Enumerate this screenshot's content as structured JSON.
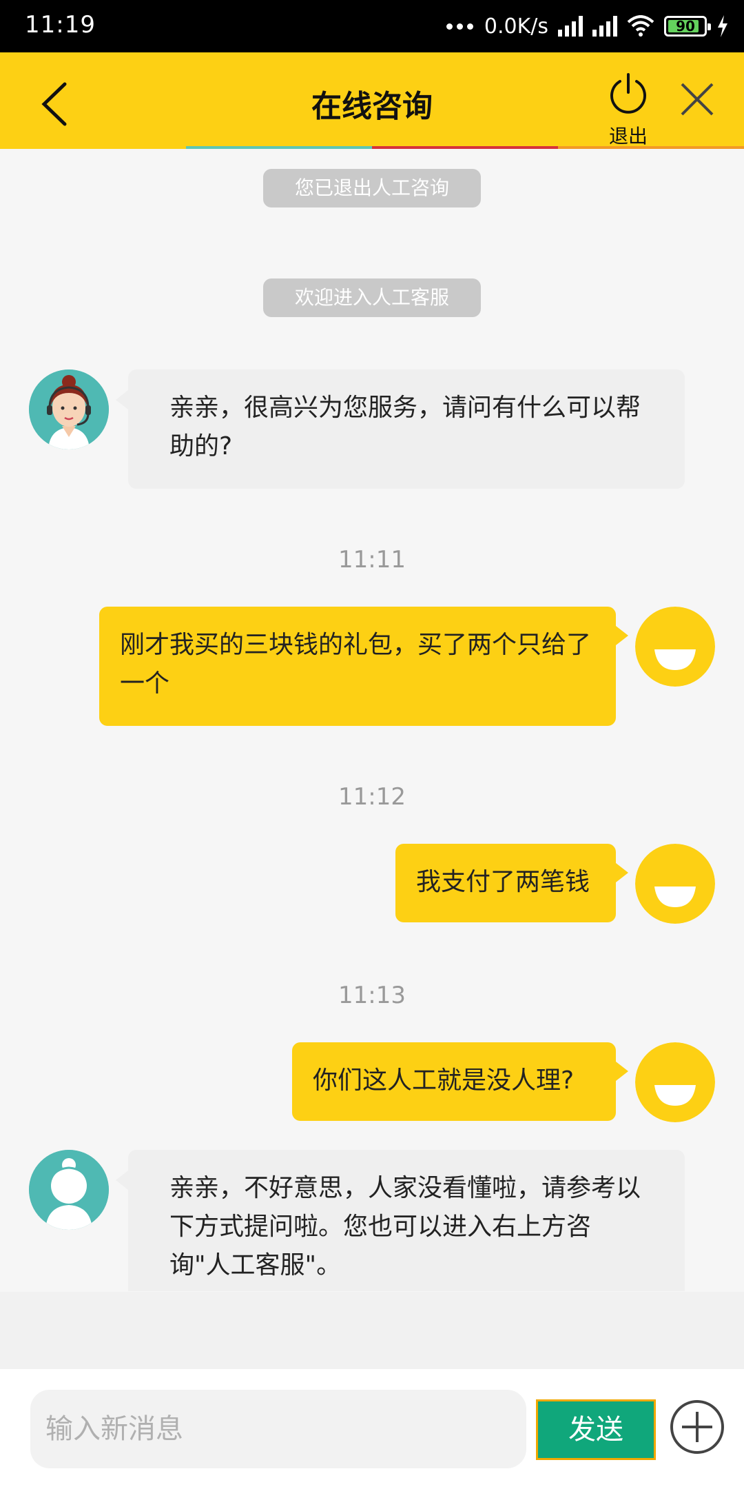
{
  "status_bar": {
    "time": "11:19",
    "network_speed": "0.0K/s",
    "battery_level": "90"
  },
  "header": {
    "title": "在线咨询",
    "exit_label": "退出",
    "accent_color": "#fdd014"
  },
  "messages": {
    "system_1": "您已退出人工咨询",
    "system_2": "欢迎进入人工客服",
    "agent_1": "亲亲，很高兴为您服务，请问有什么可以帮助的?",
    "time_1": "11:11",
    "user_1": "刚才我买的三块钱的礼包，买了两个只给了一个",
    "time_2": "11:12",
    "user_2": "我支付了两笔钱",
    "time_3": "11:13",
    "user_3": "你们这人工就是没人理?",
    "agent_2": "亲亲，不好意思，人家没看懂啦，请参考以下方式提问啦。您也可以进入右上方咨询\"人工客服\"。"
  },
  "composer": {
    "placeholder": "输入新消息",
    "send_label": "发送",
    "send_color": "#10a77b"
  }
}
